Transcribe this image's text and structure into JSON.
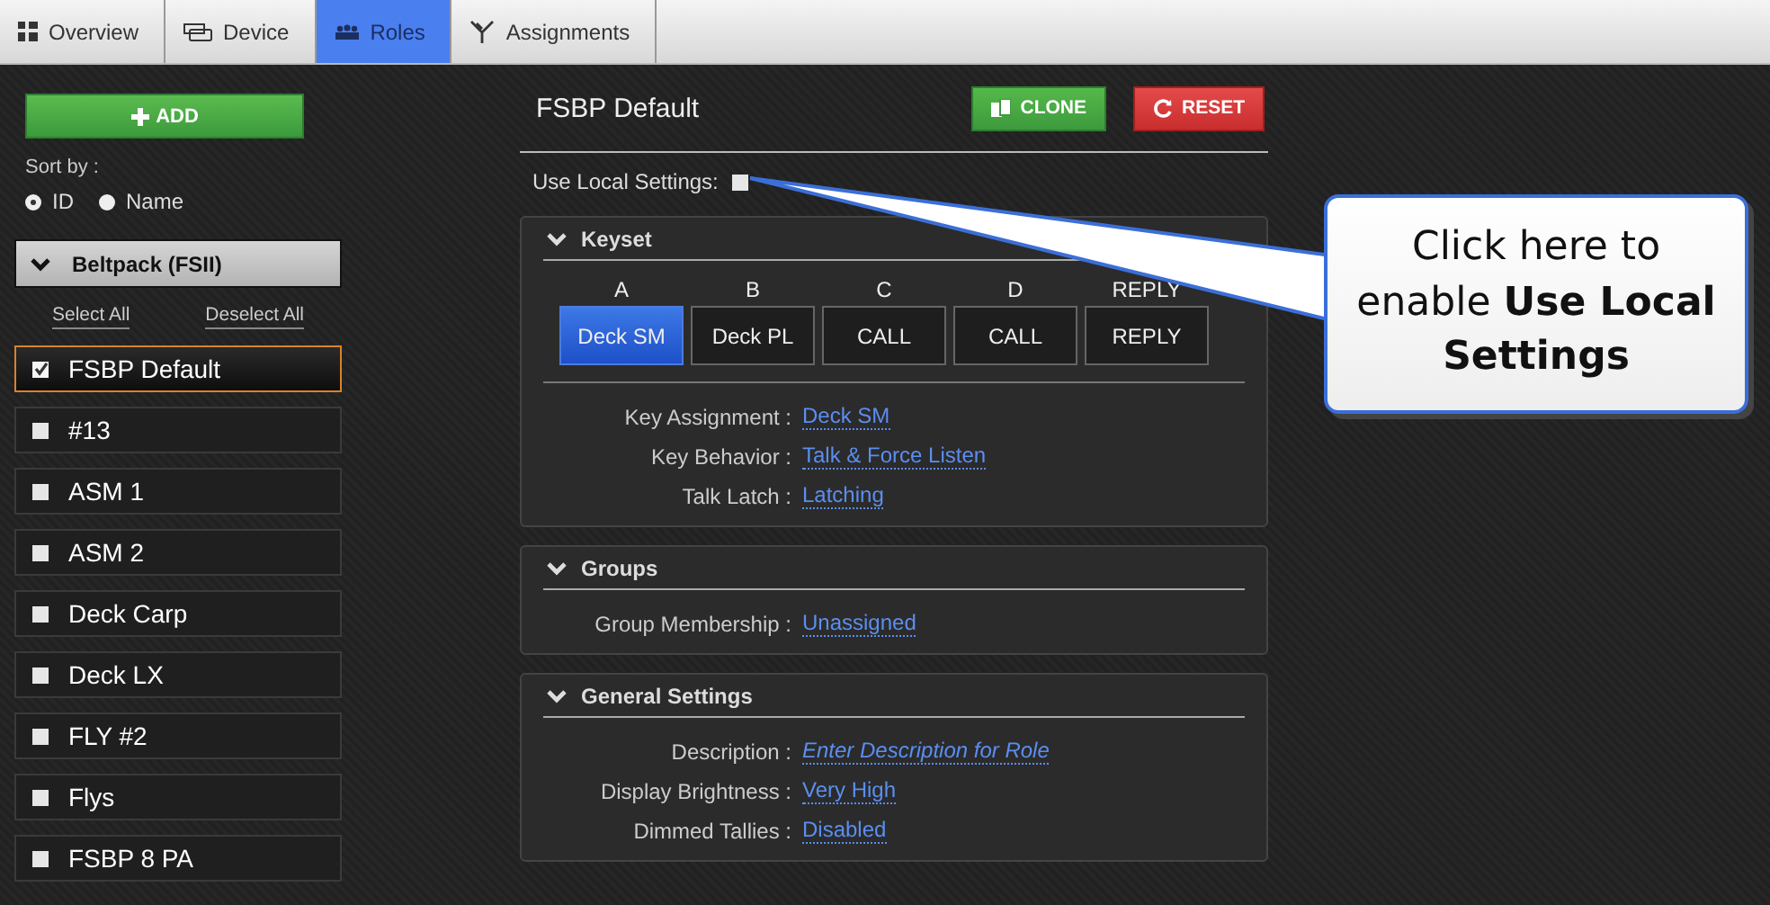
{
  "tabs": [
    {
      "label": "Overview",
      "selected": false
    },
    {
      "label": "Device",
      "selected": false
    },
    {
      "label": "Roles",
      "selected": true
    },
    {
      "label": "Assignments",
      "selected": false
    }
  ],
  "sidebar": {
    "add_button": "ADD",
    "sort_label": "Sort by :",
    "sort_options": [
      {
        "label": "ID",
        "selected": true
      },
      {
        "label": "Name",
        "selected": false
      }
    ],
    "group": {
      "title": "Beltpack (FSII)"
    },
    "select_all": "Select All",
    "deselect_all": "Deselect All",
    "items": [
      {
        "label": "FSBP Default",
        "checked": true,
        "selected": true
      },
      {
        "label": "#13",
        "checked": false,
        "selected": false
      },
      {
        "label": "ASM 1",
        "checked": false,
        "selected": false
      },
      {
        "label": "ASM 2",
        "checked": false,
        "selected": false
      },
      {
        "label": "Deck Carp",
        "checked": false,
        "selected": false
      },
      {
        "label": "Deck LX",
        "checked": false,
        "selected": false
      },
      {
        "label": "FLY #2",
        "checked": false,
        "selected": false
      },
      {
        "label": "Flys",
        "checked": false,
        "selected": false
      },
      {
        "label": "FSBP 8 PA",
        "checked": false,
        "selected": false
      }
    ]
  },
  "main": {
    "title": "FSBP Default",
    "clone_button": "CLONE",
    "reset_button": "RESET",
    "use_local_settings": {
      "label": "Use Local Settings:",
      "checked": false
    },
    "sections": [
      {
        "title": "Keyset",
        "keys": [
          {
            "letter": "A",
            "value": "Deck SM",
            "selected": true
          },
          {
            "letter": "B",
            "value": "Deck PL",
            "selected": false
          },
          {
            "letter": "C",
            "value": "CALL",
            "selected": false
          },
          {
            "letter": "D",
            "value": "CALL",
            "selected": false
          },
          {
            "letter": "REPLY",
            "value": "REPLY",
            "selected": false
          }
        ],
        "fields": [
          {
            "label": "Key Assignment :",
            "value": "Deck SM"
          },
          {
            "label": "Key Behavior :",
            "value": "Talk & Force Listen"
          },
          {
            "label": "Talk Latch :",
            "value": "Latching"
          }
        ]
      },
      {
        "title": "Groups",
        "fields": [
          {
            "label": "Group Membership :",
            "value": "Unassigned"
          }
        ]
      },
      {
        "title": "General Settings",
        "fields": [
          {
            "label": "Description :",
            "placeholder": "Enter Description for Role"
          },
          {
            "label": "Display Brightness :",
            "value": "Very High"
          },
          {
            "label": "Dimmed Tallies :",
            "value": "Disabled"
          }
        ]
      }
    ]
  },
  "callout": {
    "text": "Click here to enable **Use Local Settings**"
  }
}
